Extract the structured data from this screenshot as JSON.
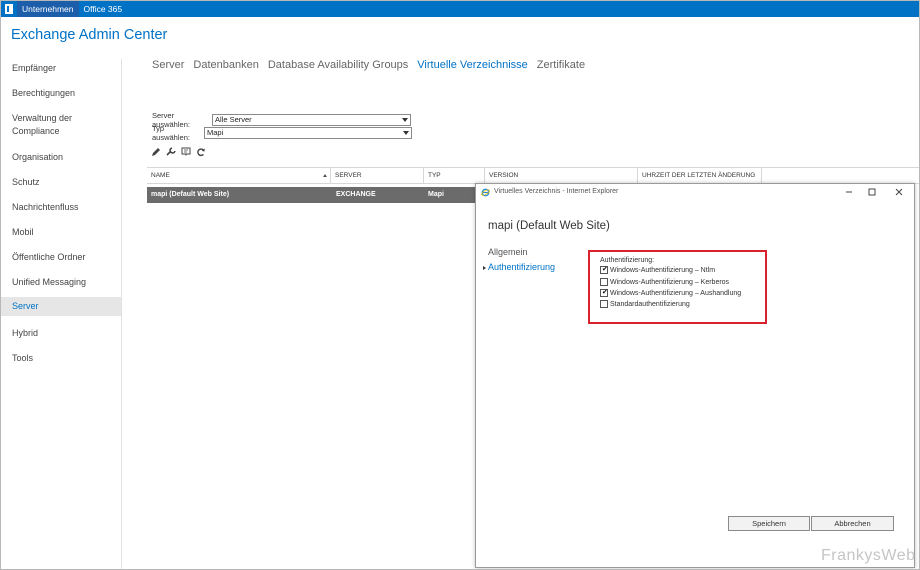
{
  "topbar": {
    "icon": "office-logo-icon",
    "links": [
      "Unternehmen",
      "Office 365"
    ]
  },
  "app_title": "Exchange Admin Center",
  "sidebar": {
    "items": [
      {
        "label": "Empfänger"
      },
      {
        "label": "Berechtigungen"
      },
      {
        "label": "Verwaltung der Compliance"
      },
      {
        "label": "Organisation"
      },
      {
        "label": "Schutz"
      },
      {
        "label": "Nachrichtenfluss"
      },
      {
        "label": "Mobil"
      },
      {
        "label": "Öffentliche Ordner"
      },
      {
        "label": "Unified Messaging"
      },
      {
        "label": "Server"
      },
      {
        "label": "Hybrid"
      },
      {
        "label": "Tools"
      }
    ],
    "active": "Server"
  },
  "tabs": {
    "items": [
      "Server",
      "Datenbanken",
      "Database Availability Groups",
      "Virtuelle Verzeichnisse",
      "Zertifikate"
    ],
    "active": "Virtuelle Verzeichnisse"
  },
  "filters": {
    "server_label": "Server auswählen:",
    "server_value": "Alle Server",
    "type_label": "Typ auswählen:",
    "type_value": "Mapi"
  },
  "toolbar": {
    "icons": [
      "edit-icon",
      "wrench-icon",
      "remote-icon",
      "refresh-icon"
    ]
  },
  "grid": {
    "columns": [
      "NAME",
      "SERVER",
      "TYP",
      "VERSION",
      "UHRZEIT DER LETZTEN ÄNDERUNG"
    ],
    "rows": [
      {
        "name": "mapi (Default Web Site)",
        "server": "EXCHANGE",
        "typ": "Mapi"
      }
    ]
  },
  "dialog": {
    "window_title": "Virtuelles Verzeichnis - Internet Explorer",
    "heading": "mapi (Default Web Site)",
    "nav": [
      "Allgemein",
      "Authentifizierung"
    ],
    "nav_active": "Authentifizierung",
    "auth": {
      "label": "Authentifizierung:",
      "options": [
        {
          "label": "Windows-Authentifizierung – Ntlm",
          "checked": true
        },
        {
          "label": "Windows-Authentifizierung – Kerberos",
          "checked": false
        },
        {
          "label": "Windows-Authentifizierung – Aushandlung",
          "checked": true
        },
        {
          "label": "Standardauthentifizierung",
          "checked": false
        }
      ]
    },
    "save_label": "Speichern",
    "cancel_label": "Abbrechen"
  },
  "watermark": "FrankysWeb",
  "colors": {
    "accent": "#0072c6",
    "highlight_border": "#d9232c",
    "selected_row": "#6b6b6b"
  }
}
